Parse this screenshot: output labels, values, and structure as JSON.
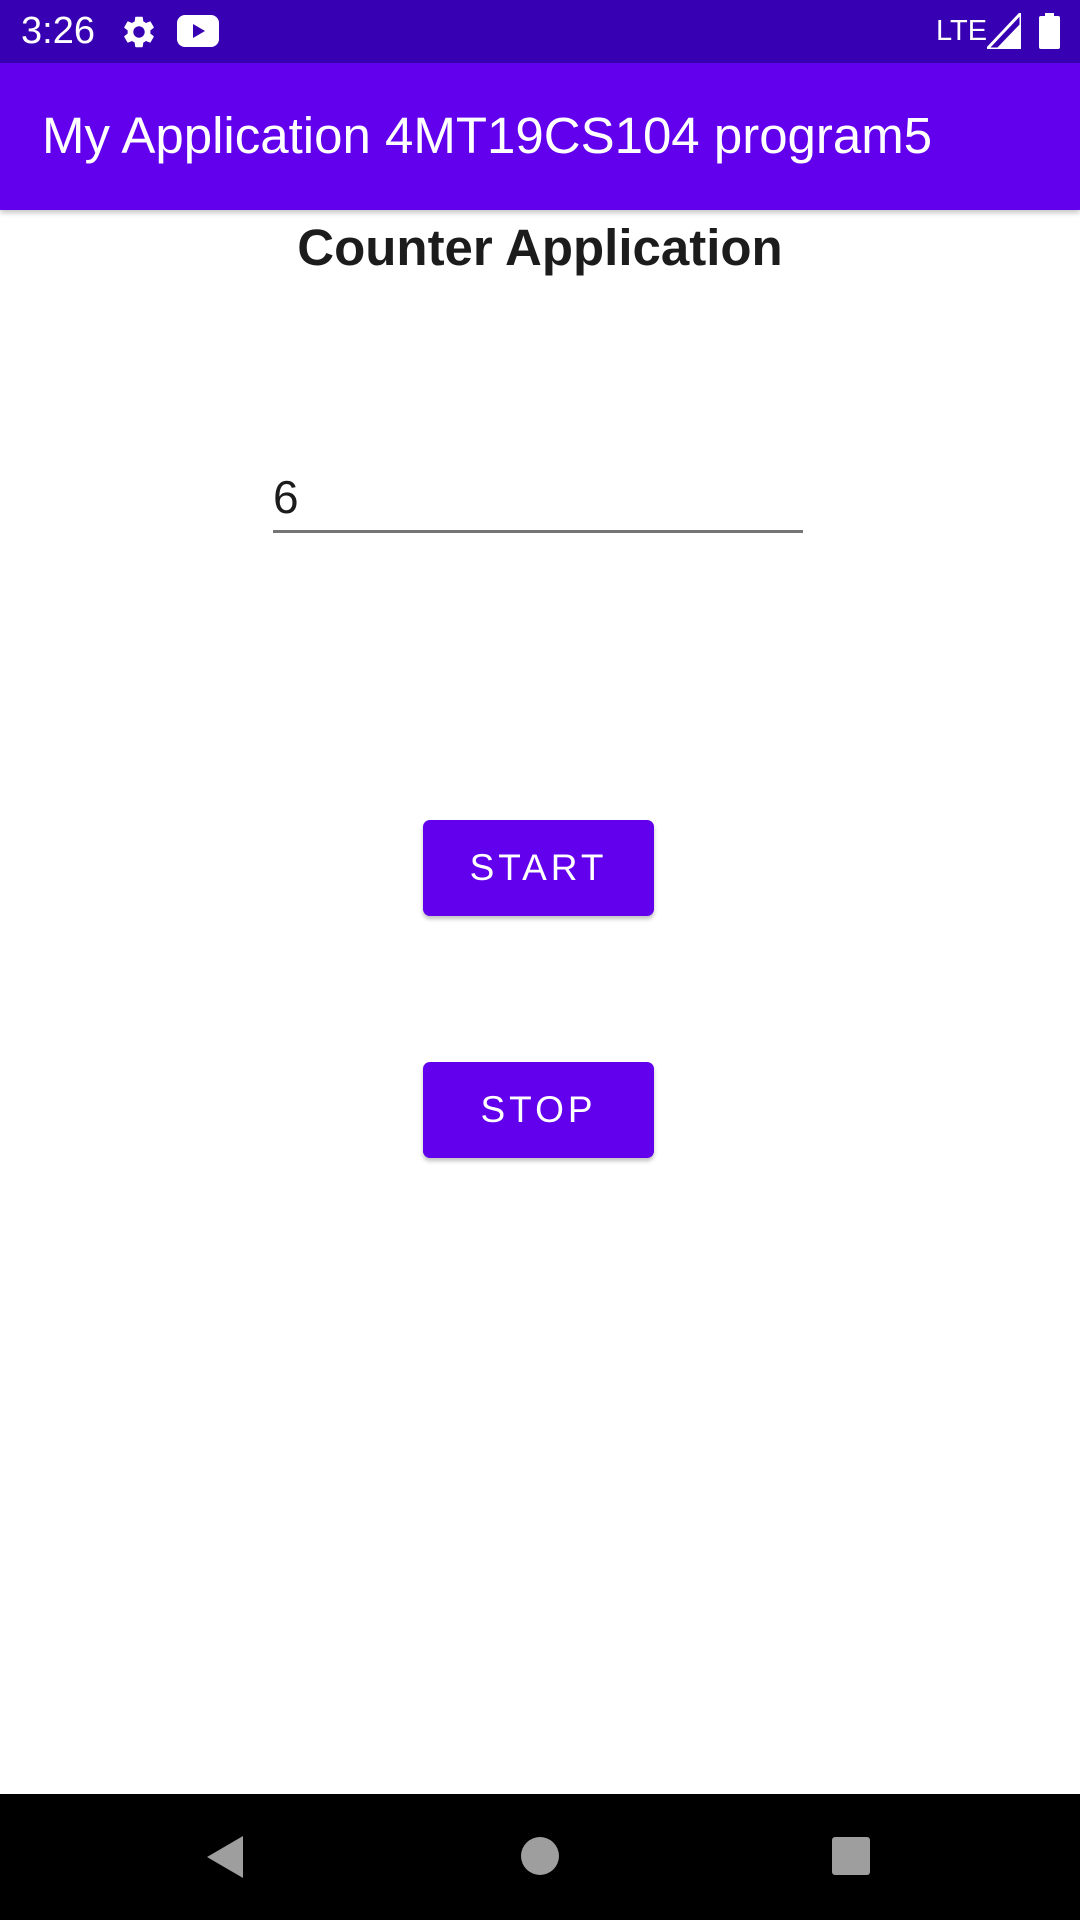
{
  "status_bar": {
    "time": "3:26",
    "network": "LTE",
    "icons": [
      "gear-icon",
      "youtube-icon",
      "signal-icon",
      "battery-icon"
    ],
    "background_color": "#3700B3"
  },
  "app_bar": {
    "title": "My Application 4MT19CS104 program5",
    "background_color": "#6200EE"
  },
  "main": {
    "heading": "Counter Application",
    "counter_value": "6",
    "start_label": "START",
    "stop_label": "STOP",
    "button_color": "#6200EE"
  },
  "nav_bar": {
    "icons": [
      "back-icon",
      "home-icon",
      "recents-icon"
    ]
  }
}
